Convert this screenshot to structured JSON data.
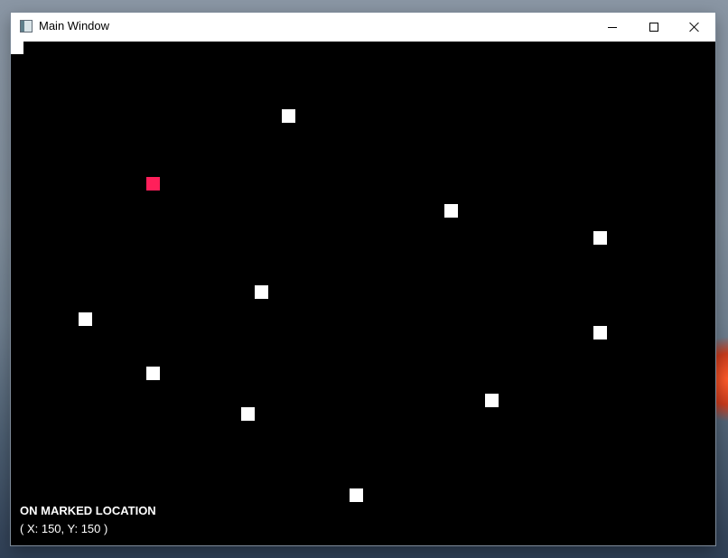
{
  "window": {
    "title": "Main Window",
    "icon": "app-window-icon",
    "controls": [
      {
        "name": "minimize",
        "icon": "minimize-icon"
      },
      {
        "name": "maximize",
        "icon": "maximize-icon"
      },
      {
        "name": "close",
        "icon": "close-icon"
      }
    ]
  },
  "canvas": {
    "background": "#000000",
    "status": {
      "label": "ON MARKED LOCATION",
      "coords": "( X: 150, Y: 150 )"
    }
  },
  "colors": {
    "marker": "#ffffff",
    "highlight_marker": "#ff1f5a",
    "titlebar": "#ffffff"
  }
}
